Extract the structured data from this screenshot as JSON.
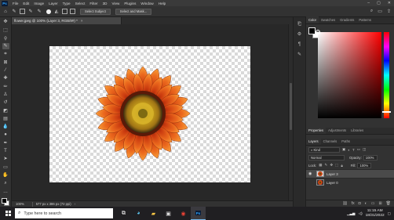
{
  "app": {
    "logo": "Ps"
  },
  "menu": [
    "File",
    "Edit",
    "Image",
    "Layer",
    "Type",
    "Select",
    "Filter",
    "3D",
    "View",
    "Plugins",
    "Window",
    "Help"
  ],
  "options": {
    "select_subject": "Select Subject",
    "select_and_mask": "Select and Mask..."
  },
  "document": {
    "tab_title": "flower.jpeg @ 100% (Layer 3, RGB/8#) *",
    "close": "×"
  },
  "status": {
    "zoom": "100%",
    "doc_info": "577 px x 386 px (72 ppi)",
    "arrow": "›"
  },
  "panels": {
    "color_tabs": [
      "Color",
      "Swatches",
      "Gradients",
      "Patterns"
    ],
    "mid_tabs": [
      "Properties",
      "Adjustments",
      "Libraries"
    ],
    "layer_tabs": [
      "Layers",
      "Channels",
      "Paths"
    ],
    "kind": "Kind",
    "blend_mode": "Normal",
    "opacity_label": "Opacity:",
    "opacity_value": "100%",
    "lock_label": "Lock:",
    "fill_label": "Fill:",
    "fill_value": "100%",
    "layers": [
      {
        "name": "Layer 3",
        "selected": true
      },
      {
        "name": "Layer 0",
        "selected": false
      }
    ]
  },
  "taskbar": {
    "search_placeholder": "Type here to search",
    "time": "11:15 AM",
    "date": "18/31/2022",
    "ps_label": "Ps"
  },
  "colors": {
    "accent": "#31a8ff",
    "petal": "#e0531b",
    "center": "#c9a21c"
  }
}
